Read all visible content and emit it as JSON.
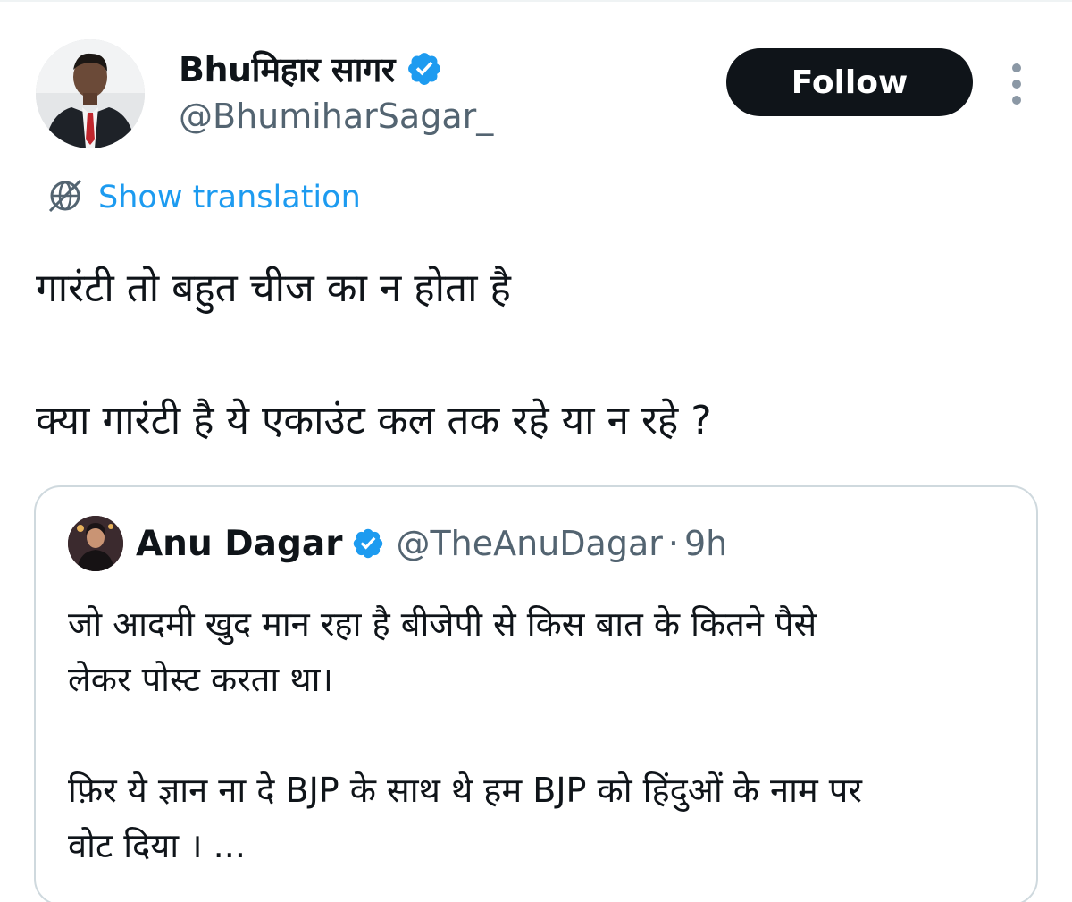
{
  "author": {
    "display_name": "Bhuमिहार सागर",
    "handle": "@BhumiharSagar_",
    "verified_icon": "verified-badge-icon"
  },
  "actions": {
    "follow_label": "Follow",
    "more_icon": "more-vertical-icon"
  },
  "translation": {
    "icon": "translate-globe-icon",
    "label": "Show translation"
  },
  "tweet": {
    "line1": "गारंटी तो बहुत चीज का न होता है",
    "line2": "क्या गारंटी है ये एकाउंट कल तक रहे या न रहे ?"
  },
  "quote": {
    "display_name": "Anu Dagar",
    "handle": "@TheAnuDagar",
    "separator": "·",
    "time": "9h",
    "line1": "जो आदमी खुद मान रहा है बीजेपी से किस बात के कितने पैसे",
    "line2": "लेकर पोस्ट करता था।",
    "line3": "फ़िर ये ज्ञान ना दे BJP के साथ थे हम BJP को हिंदुओं के नाम पर",
    "line4": "वोट दिया । ..."
  },
  "colors": {
    "accent": "#1d9bf0",
    "text_primary": "#0f1419",
    "text_secondary": "#536471",
    "border": "#cfd9de",
    "button_bg": "#0f1419"
  }
}
